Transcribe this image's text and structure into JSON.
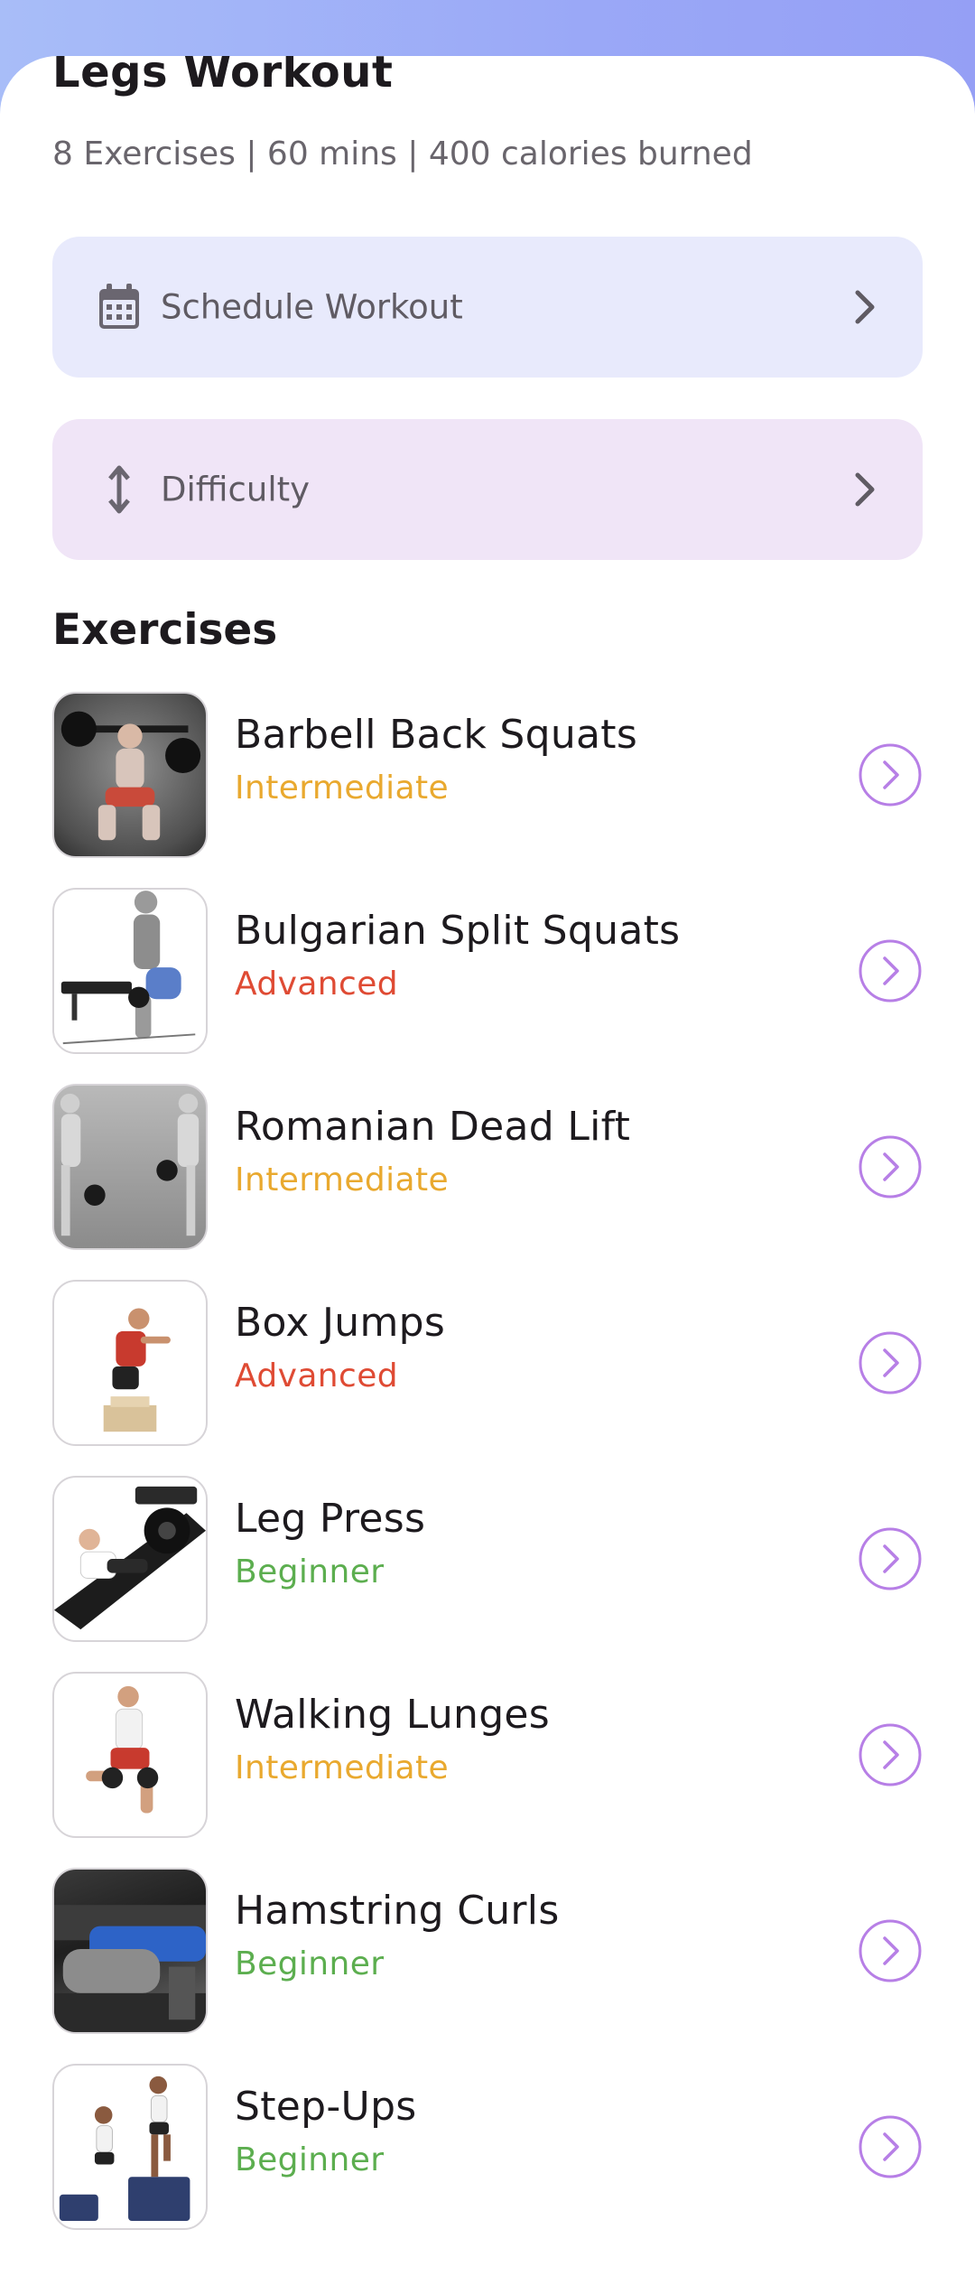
{
  "workout": {
    "title": "Legs Workout",
    "summary": "8 Exercises | 60 mins | 400 calories burned"
  },
  "actions": {
    "schedule": {
      "label": "Schedule Workout",
      "icon": "calendar-icon"
    },
    "difficulty": {
      "label": "Difficulty",
      "icon": "vertical-arrows-icon"
    }
  },
  "section_title": "Exercises",
  "level_colors": {
    "Intermediate": "#e9a92f",
    "Advanced": "#df4b34",
    "Beginner": "#5cae4f"
  },
  "accent_color": "#b77fe6",
  "exercises": [
    {
      "name": "Barbell Back Squats",
      "level": "Intermediate"
    },
    {
      "name": "Bulgarian Split Squats",
      "level": "Advanced"
    },
    {
      "name": "Romanian Dead Lift",
      "level": "Intermediate"
    },
    {
      "name": "Box Jumps",
      "level": "Advanced"
    },
    {
      "name": "Leg Press",
      "level": "Beginner"
    },
    {
      "name": "Walking Lunges",
      "level": "Intermediate"
    },
    {
      "name": "Hamstring Curls",
      "level": "Beginner"
    },
    {
      "name": "Step-Ups",
      "level": "Beginner"
    }
  ]
}
